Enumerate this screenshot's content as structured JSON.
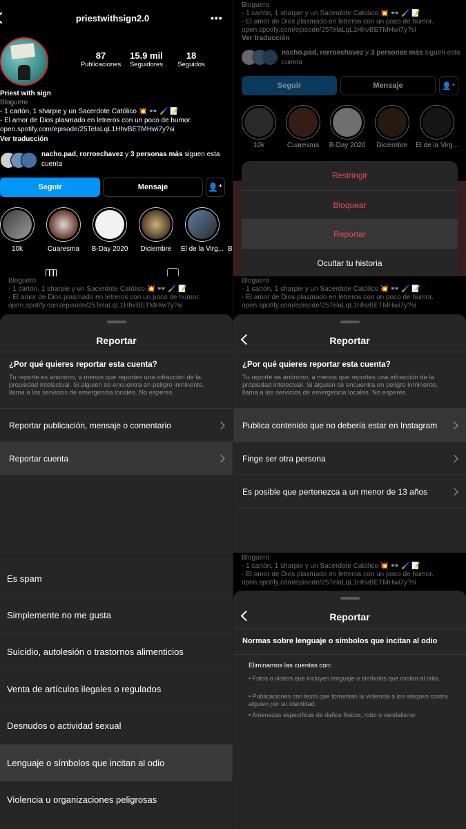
{
  "profile": {
    "username": "priestwithsign2.0",
    "posts_count": "87",
    "posts_label": "Publicaciones",
    "followers_count": "15.9 mil",
    "followers_label": "Seguidores",
    "following_count": "18",
    "following_label": "Seguidos",
    "name": "Priest with sign",
    "category": "Bloguero",
    "bio_line1": "- 1 cartón, 1 sharpie y un Sacerdote Católico 💥 👓 🖌️ 📝",
    "bio_line2": "- El amor de Dios plasmado en letreros con un poco de humor.",
    "link": "open.spotify.com/episode/25TelaLqL1HhvBETMHwi7y?si",
    "see_translation": "Ver traducción",
    "followed_by_names": "nacho.pad, rorroechavez",
    "followed_by_and": " y ",
    "followed_by_more": "3 personas más",
    "followed_by_suffix": " siguen esta cuenta",
    "follow_button": "Seguir",
    "message_button": "Mensaje"
  },
  "highlights": [
    "10k",
    "Cuaresma",
    "B-Day 2020",
    "Diciembre",
    "El de la Virg...",
    "B"
  ],
  "menu": {
    "restrict": "Restringir",
    "block": "Bloquear",
    "report": "Reportar",
    "hide_story": "Ocultar tu historia"
  },
  "report_sheet_1": {
    "title": "Reportar",
    "question": "¿Por qué quieres reportar esta cuenta?",
    "notice": "Tu reporte es anónimo, a menos que reportes una infracción de la propiedad intelectual. Si alguien se encuentra en peligro inminente, llama a los servicios de emergencia locales. No esperes.",
    "options": [
      "Reportar publicación, mensaje o comentario",
      "Reportar cuenta"
    ]
  },
  "report_sheet_2": {
    "title": "Reportar",
    "question": "¿Por qué quieres reportar esta cuenta?",
    "notice": "Tu reporte es anónimo, a menos que reportes una infracción de la propiedad intelectual. Si alguien se encuentra en peligro inminente, llama a los servicios de emergencia locales. No esperes.",
    "options": [
      "Publica contenido que no debería estar en Instagram",
      "Finge ser otra persona",
      "Es posible que pertenezca a un menor de 13 años"
    ]
  },
  "report_reasons": [
    "Es spam",
    "Simplemente no me gusta",
    "Suicidio, autolesión o trastornos alimenticios",
    "Venta de artículos ilegales o regulados",
    "Desnudos o actividad sexual",
    "Lenguaje o símbolos que incitan al odio",
    "Violencia u organizaciones peligrosas"
  ],
  "report_sheet_3": {
    "title": "Reportar",
    "heading": "Normas sobre lenguaje o símbolos que incitan al odio",
    "intro": "Eliminamos las cuentas con:",
    "bullets": [
      "Fotos o videos que incluyen lenguaje o símbolos que incitan al odio.",
      "Publicaciones con texto que fomentan la violencia o los ataques contra alguien por su identidad.",
      "Amenazas específicas de daños físicos, robo o vandalismo."
    ]
  },
  "colors": {
    "accent_blue": "#0095f6",
    "danger_red": "#ed4956",
    "sheet_bg": "#262626"
  },
  "icons": [
    "back-arrow-icon",
    "more-options-icon",
    "add-person-icon",
    "grid-icon",
    "tagged-icon",
    "chevron-right-icon"
  ]
}
